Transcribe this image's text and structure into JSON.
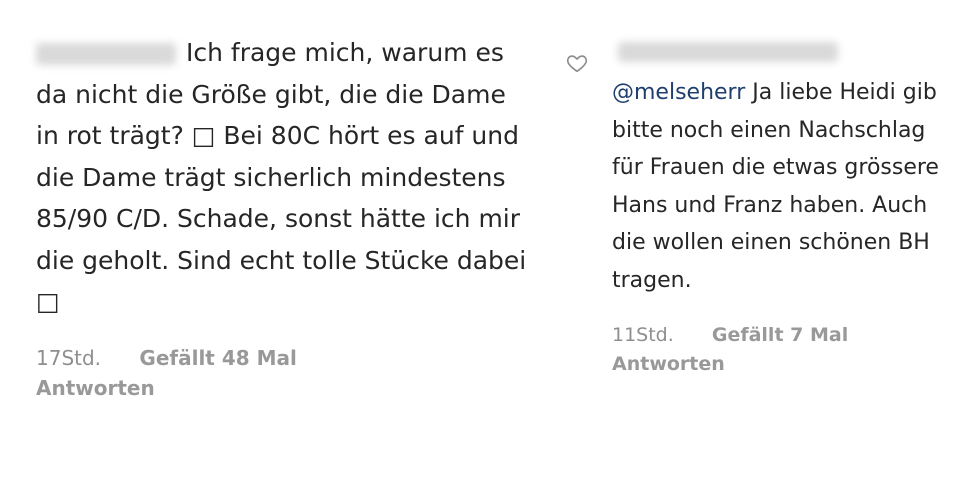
{
  "comments": [
    {
      "text": "Ich frage mich, warum es da nicht die Größe gibt, die die Dame in rot trägt? □ Bei 80C hört es auf und die Dame trägt sicherlich mindestens 85/90 C/D. Schade, sonst hätte ich mir die geholt. Sind echt tolle Stücke dabei □",
      "time": "17Std.",
      "likes": "Gefällt 48 Mal",
      "reply": "Antworten"
    },
    {
      "mention": "@melseherr",
      "text": " Ja liebe Heidi gib bitte noch einen Nachschlag für Frauen die etwas grössere Hans und Franz haben. Auch die wollen einen schönen BH tragen.",
      "time": "11Std.",
      "likes": "Gefällt 7 Mal",
      "reply": "Antworten"
    }
  ],
  "icons": {
    "like": "heart-outline-icon"
  },
  "colors": {
    "text": "#262626",
    "meta": "#8e8e8e",
    "mention": "#1f3f6e"
  }
}
